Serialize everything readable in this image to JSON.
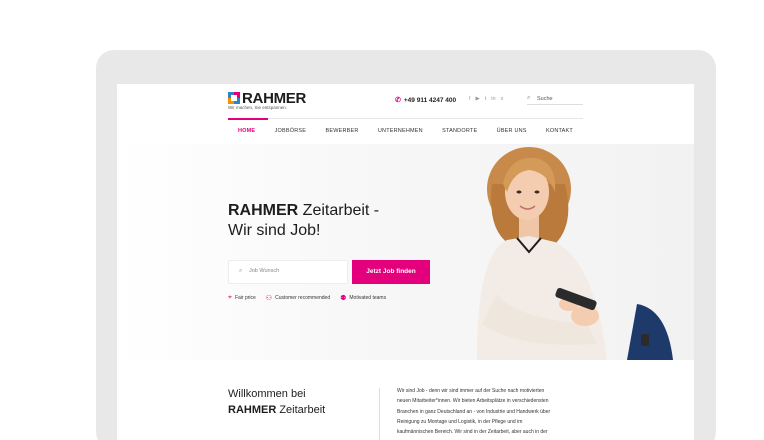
{
  "header": {
    "logo_text": "RAHMER",
    "logo_tagline": "Wir machen, Sie entspannen.",
    "phone": "+49 911 4247 400",
    "socials": [
      "f",
      "▶",
      "t",
      "in",
      "x"
    ],
    "search_placeholder": "Suche"
  },
  "nav": {
    "items": [
      {
        "label": "HOME",
        "active": true
      },
      {
        "label": "JOBBÖRSE"
      },
      {
        "label": "BEWERBER"
      },
      {
        "label": "UNTERNEHMEN"
      },
      {
        "label": "STANDORTE"
      },
      {
        "label": "ÜBER UNS"
      },
      {
        "label": "KONTAKT"
      }
    ]
  },
  "hero": {
    "title_bold": "RAHMER",
    "title_rest": " Zeitarbeit -",
    "title_line2": "Wir sind Job!",
    "job_placeholder": "Job Wunsch",
    "job_button": "Jetzt Job finden",
    "features": [
      {
        "icon": "price-tag-icon",
        "label": "Fair price"
      },
      {
        "icon": "user-icon",
        "label": "Customer recommended"
      },
      {
        "icon": "team-icon",
        "label": "Motivated teams"
      }
    ]
  },
  "welcome": {
    "title_line1": "Willkommen bei",
    "title_bold": "RAHMER",
    "title_rest": " Zeitarbeit",
    "text_lines": [
      "Wir sind Job - denn wir sind immer auf der Suche nach motivierten",
      "neuen Mitarbeiter*innen. Wir bieten Arbeitsplätze in verschiedensten",
      "Branchen in ganz Deutschland an - von Industrie und Handwerk über",
      "Reinigung zu Montage und Logistik, in der Pflege und im",
      "kaufmännischen Bereich. Wir sind in der Zeitarbeit, aber auch in der"
    ]
  },
  "colors": {
    "accent": "#e4007c",
    "logo_blue": "#2a86c8",
    "logo_orange": "#f39200"
  }
}
